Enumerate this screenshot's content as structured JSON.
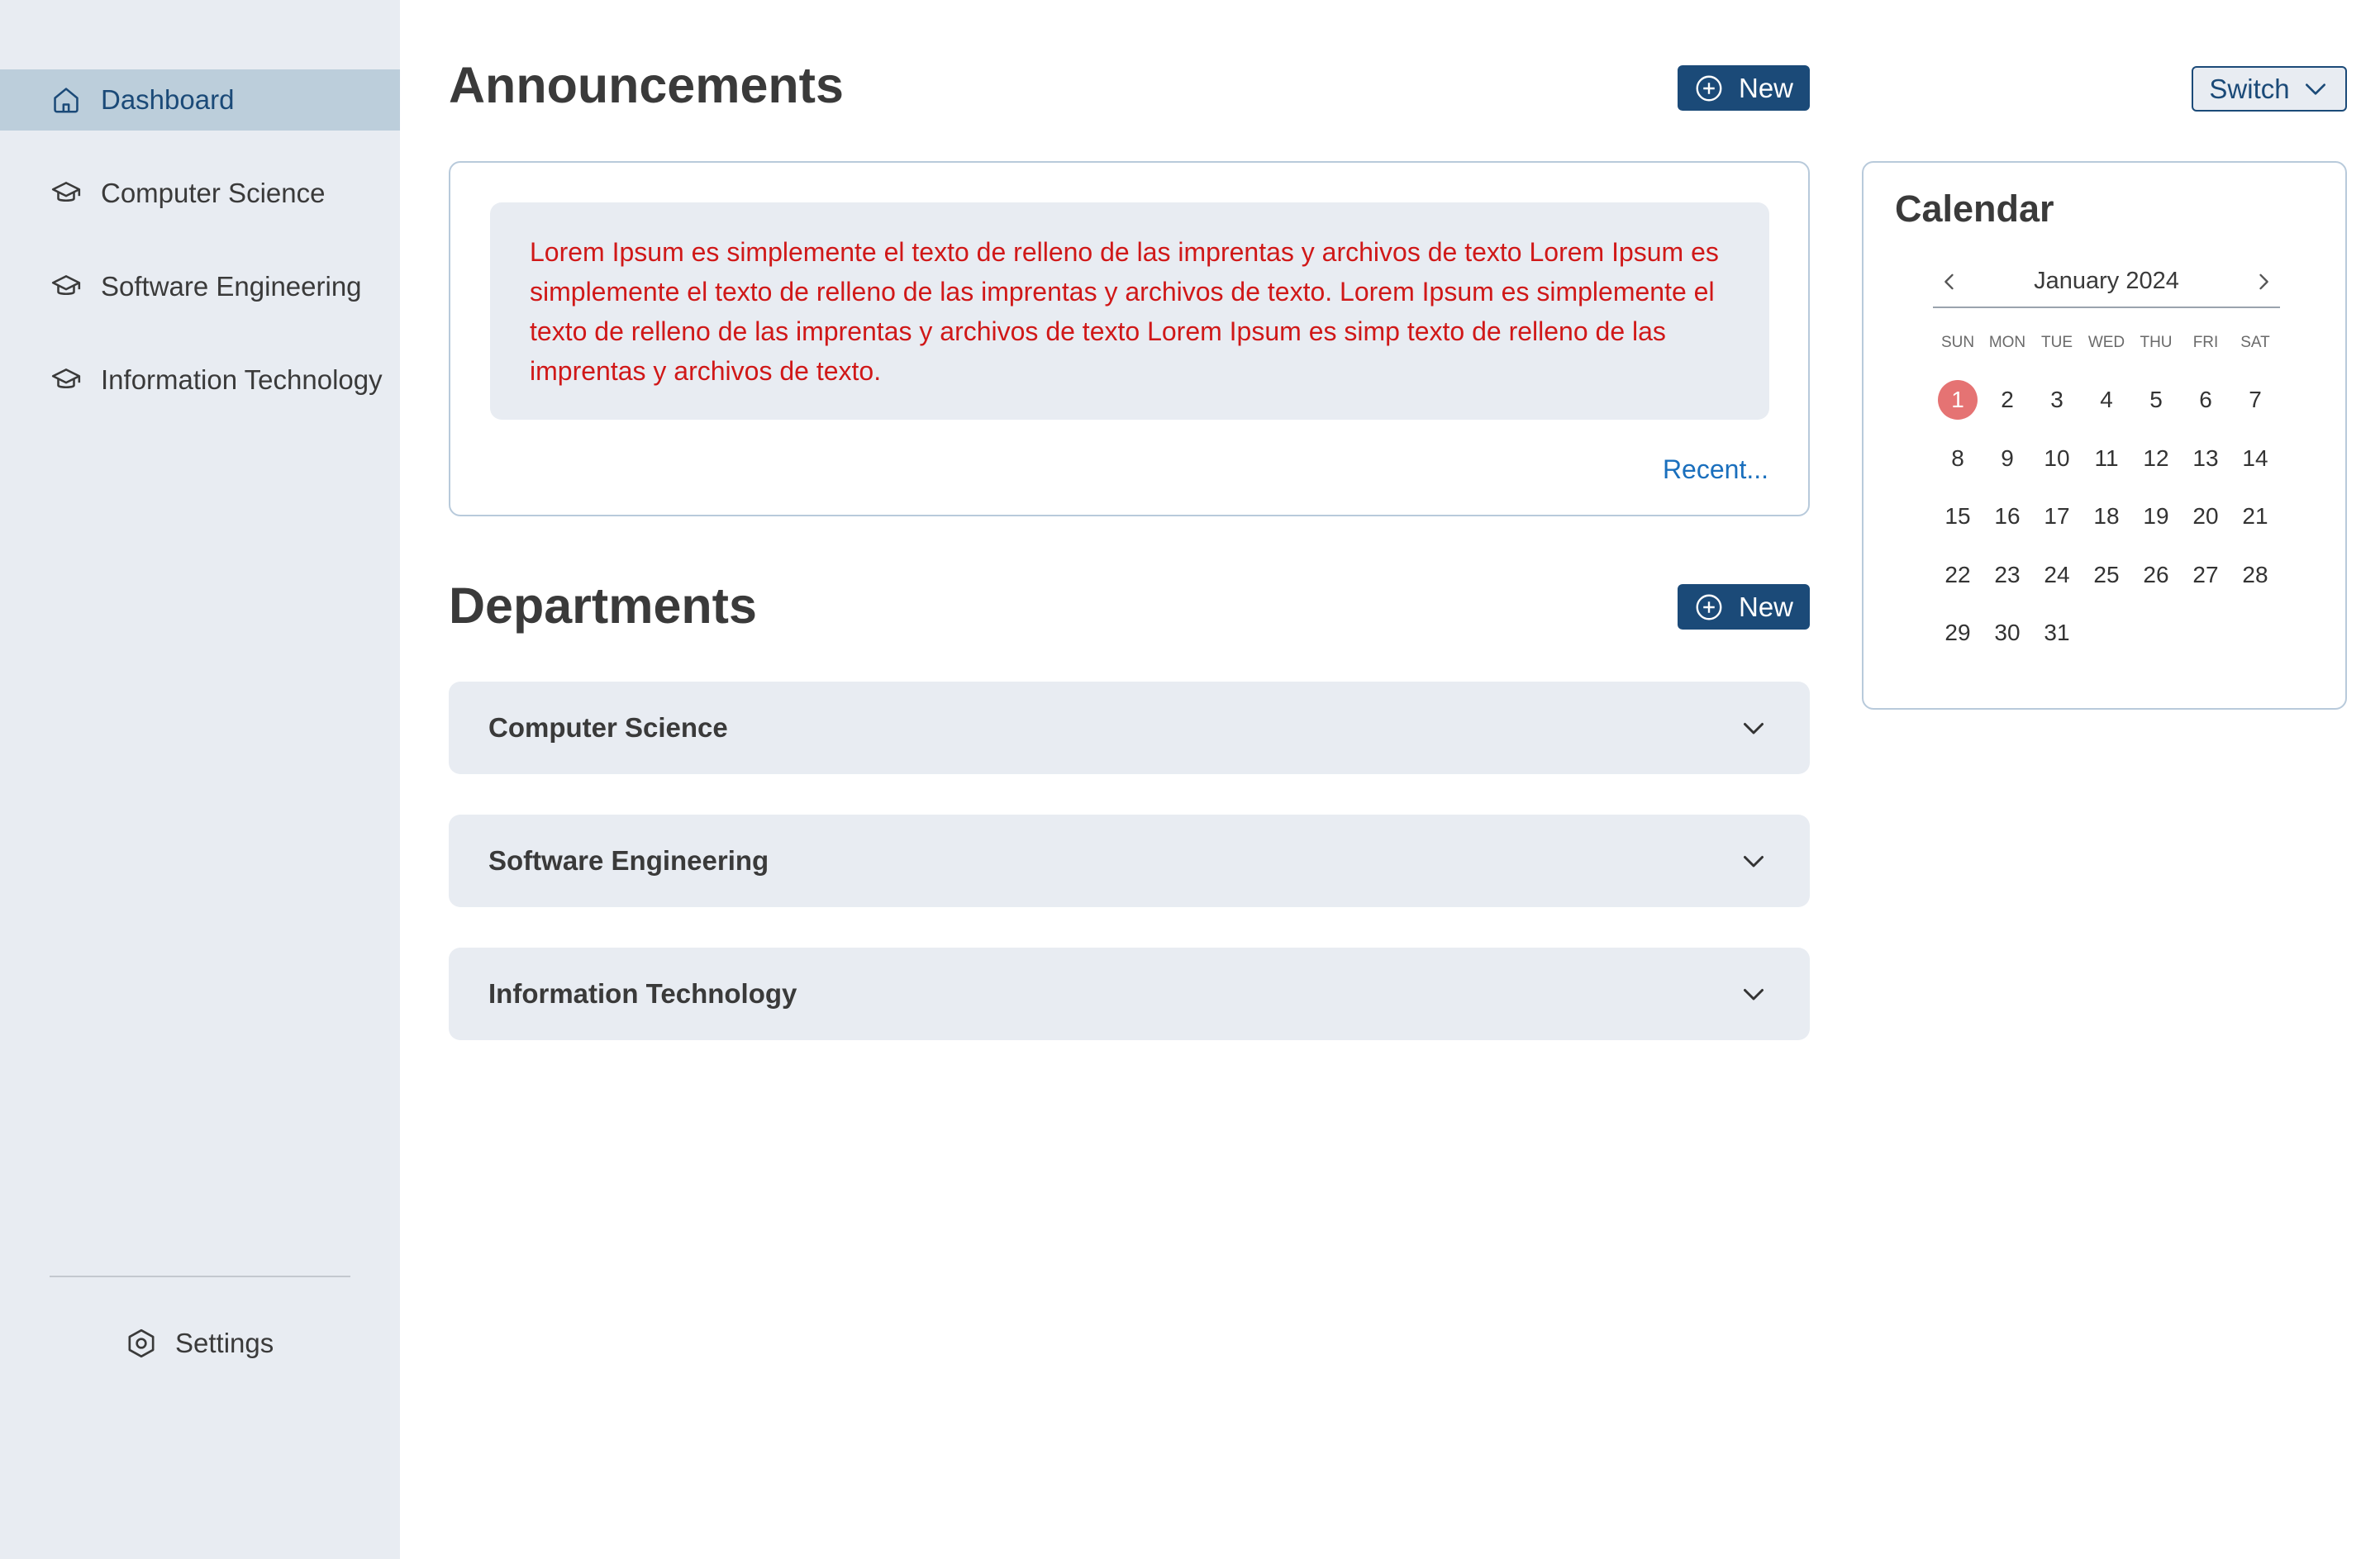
{
  "sidebar": {
    "items": [
      {
        "label": "Dashboard",
        "icon": "home-icon",
        "active": true
      },
      {
        "label": "Computer Science",
        "icon": "graduation-cap-icon"
      },
      {
        "label": "Software Engineering",
        "icon": "graduation-cap-icon"
      },
      {
        "label": "Information Technology",
        "icon": "graduation-cap-icon"
      }
    ],
    "settings_label": "Settings"
  },
  "announcements": {
    "title": "Announcements",
    "new_label": "New",
    "text": "Lorem Ipsum es simplemente el texto de relleno de las imprentas y archivos de texto Lorem Ipsum es simplemente el texto de relleno de las imprentas y archivos de texto. Lorem Ipsum es simplemente el texto de relleno de las imprentas y archivos de texto Lorem Ipsum es simp texto de relleno de las imprentas y archivos de texto.",
    "recent_label": "Recent..."
  },
  "departments": {
    "title": "Departments",
    "new_label": "New",
    "items": [
      {
        "label": "Computer Science"
      },
      {
        "label": "Software Engineering"
      },
      {
        "label": "Information Technology"
      }
    ]
  },
  "switch_label": "Switch",
  "calendar": {
    "title": "Calendar",
    "month": "January 2024",
    "weekdays": [
      "SUN",
      "MON",
      "TUE",
      "WED",
      "THU",
      "FRI",
      "SAT"
    ],
    "days": [
      "1",
      "2",
      "3",
      "4",
      "5",
      "6",
      "7",
      "8",
      "9",
      "10",
      "11",
      "12",
      "13",
      "14",
      "15",
      "16",
      "17",
      "18",
      "19",
      "20",
      "21",
      "22",
      "23",
      "24",
      "25",
      "26",
      "27",
      "28",
      "29",
      "30",
      "31"
    ],
    "today": "1"
  },
  "colors": {
    "brand": "#1b4a78",
    "sidebar_bg": "#e8ecf2",
    "active_bg": "#bccedb",
    "announcement_text": "#d01818",
    "link": "#1a6fbd",
    "today": "#e57373"
  }
}
